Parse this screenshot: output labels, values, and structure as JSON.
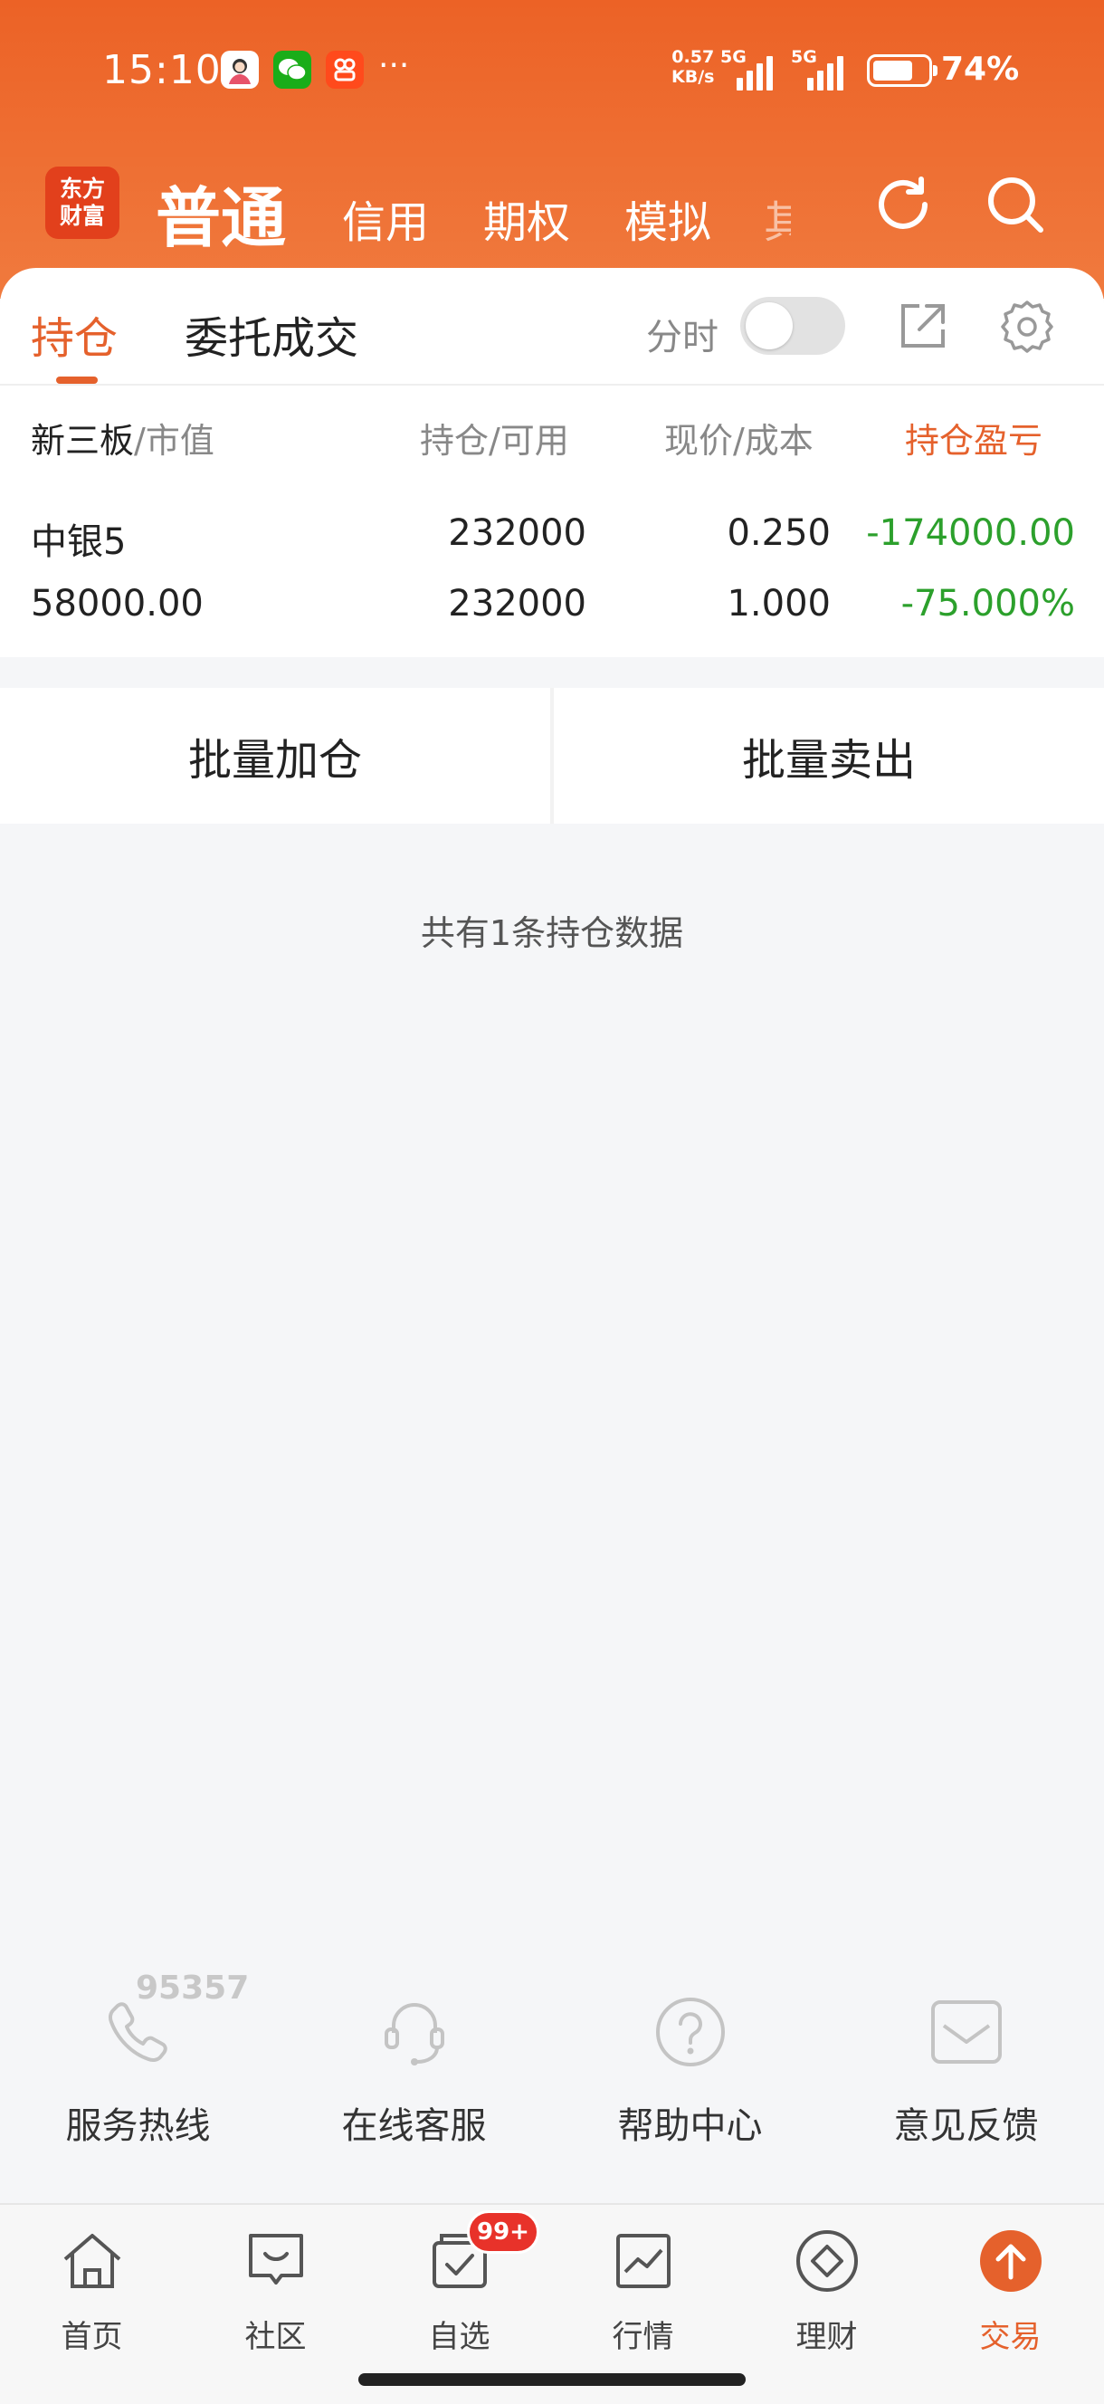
{
  "status_bar": {
    "time": "15:10",
    "net_speed_value": "0.57",
    "net_speed_unit": "KB/s",
    "sim1": "5G",
    "sim2": "5G",
    "battery_percent": "74%",
    "battery_level": 0.74,
    "icons": [
      "avatar-icon",
      "wechat-icon",
      "app-icon",
      "more-dots-icon"
    ],
    "more_dots": "···"
  },
  "header": {
    "logo_line1": "东方",
    "logo_line2": "财富",
    "tabs": [
      {
        "label": "普通",
        "active": true
      },
      {
        "label": "信用",
        "active": false
      },
      {
        "label": "期权",
        "active": false
      },
      {
        "label": "模拟",
        "active": false
      },
      {
        "label": "其",
        "active": false
      }
    ],
    "actions": [
      "refresh-icon",
      "search-icon"
    ]
  },
  "subtabs": {
    "items": [
      {
        "label": "持仓",
        "active": true
      },
      {
        "label": "委托成交",
        "active": false
      }
    ],
    "fenshi_label": "分时",
    "fenshi_on": false,
    "actions": [
      "share-icon",
      "settings-icon"
    ]
  },
  "table": {
    "headers": {
      "col1_market": "新三板",
      "col1_rest": "/市值",
      "col2": "持仓/可用",
      "col3": "现价/成本",
      "col4": "持仓盈亏"
    },
    "rows": [
      {
        "name": "中银5",
        "market_value": "58000.00",
        "position": "232000",
        "available": "232000",
        "price": "0.250",
        "cost": "1.000",
        "profit": "-174000.00",
        "profit_pct": "-75.000%"
      }
    ]
  },
  "batch": {
    "add_label": "批量加仓",
    "sell_label": "批量卖出"
  },
  "summary_text": "共有1条持仓数据",
  "services": [
    {
      "label": "服务热线",
      "icon": "phone-icon"
    },
    {
      "label": "在线客服",
      "icon": "headset-icon"
    },
    {
      "label": "帮助中心",
      "icon": "question-icon"
    },
    {
      "label": "意见反馈",
      "icon": "mail-icon"
    }
  ],
  "hotline_number": "95357",
  "bottom_nav": {
    "items": [
      {
        "label": "首页",
        "icon": "home-icon",
        "active": false
      },
      {
        "label": "社区",
        "icon": "chat-icon",
        "active": false
      },
      {
        "label": "自选",
        "icon": "watchlist-icon",
        "active": false
      },
      {
        "label": "行情",
        "icon": "chart-icon",
        "active": false
      },
      {
        "label": "理财",
        "icon": "diamond-icon",
        "active": false
      },
      {
        "label": "交易",
        "icon": "trade-icon",
        "active": true
      }
    ],
    "badge": "99+"
  },
  "colors": {
    "brand_orange": "#ec6226",
    "accent": "#e5612c",
    "loss_green": "#2ca02c",
    "badge_red": "#e8322a"
  }
}
